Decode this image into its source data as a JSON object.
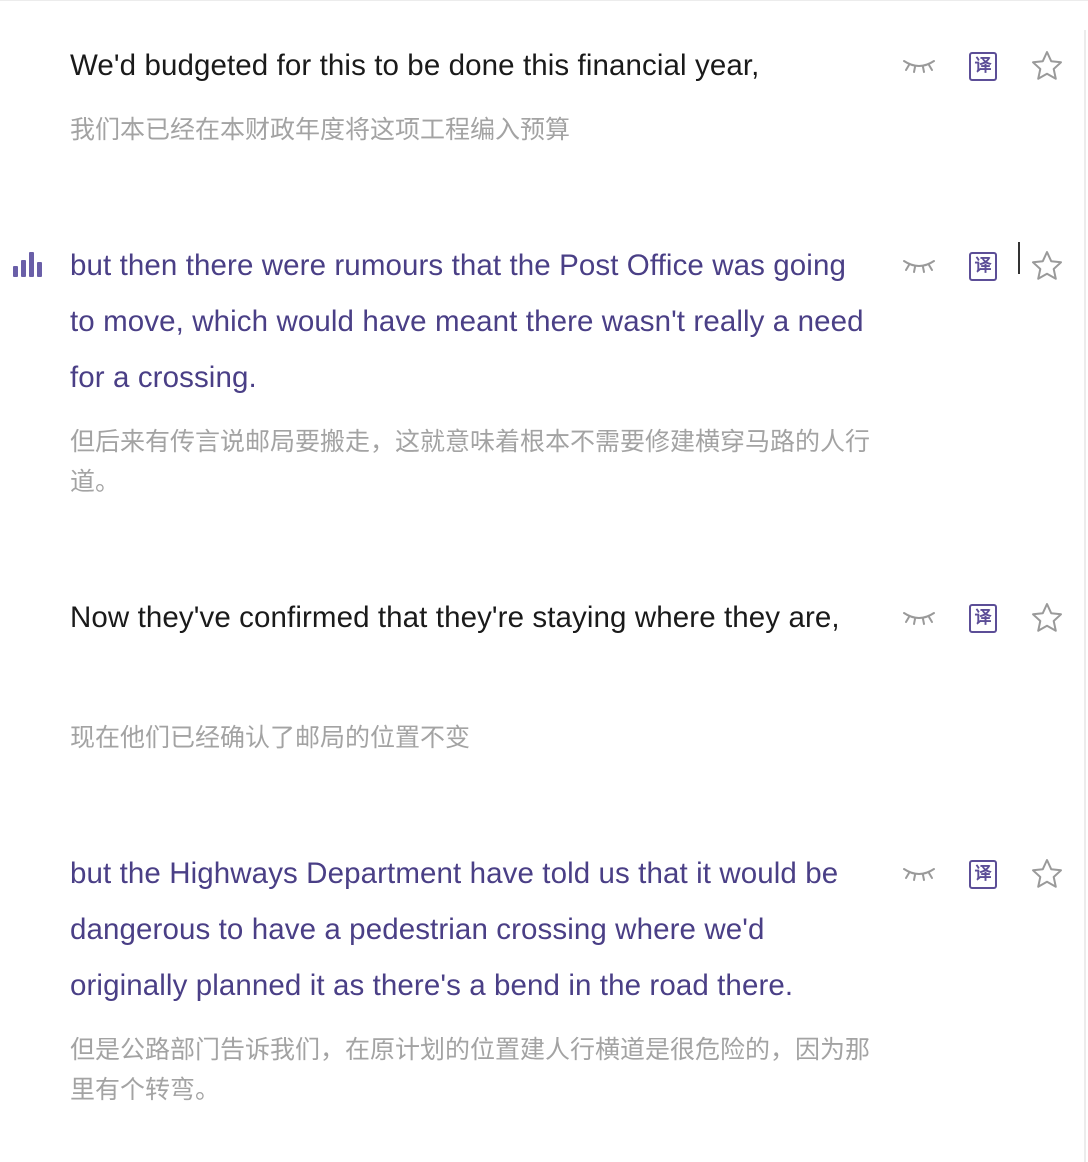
{
  "app": {
    "colors": {
      "accent": "#5c4e97",
      "highlight_text": "#4a3f86",
      "primary_text": "#1a1a1a",
      "translation_text": "#a3a3a3",
      "icon_gray": "#9a9a9a"
    },
    "icons": {
      "playing": "audio-bars-icon",
      "hide": "closed-eye-icon",
      "translate": "translate-icon",
      "favorite": "star-icon"
    }
  },
  "sentences": [
    {
      "en": "We'd budgeted for this to be done this financial year,",
      "zh": "我们本已经在本财政年度将这项工程编入预算",
      "translate_label": "译"
    },
    {
      "en": "but then there were rumours that the Post Office was going to move, which would have meant there wasn't really a need for a crossing.",
      "zh": "但后来有传言说邮局要搬走，这就意味着根本不需要修建横穿马路的人行道。",
      "translate_label": "译",
      "playing": true
    },
    {
      "en": "Now they've confirmed that they're staying where they are,",
      "zh": "现在他们已经确认了邮局的位置不变",
      "translate_label": "译"
    },
    {
      "en": "but the Highways Department have told us that it would be dangerous to have a pedestrian crossing where we'd originally planned it as there's a bend in the road there.",
      "zh": "但是公路部门告诉我们，在原计划的位置建人行横道是很危险的，因为那里有个转弯。",
      "translate_label": "译"
    }
  ]
}
